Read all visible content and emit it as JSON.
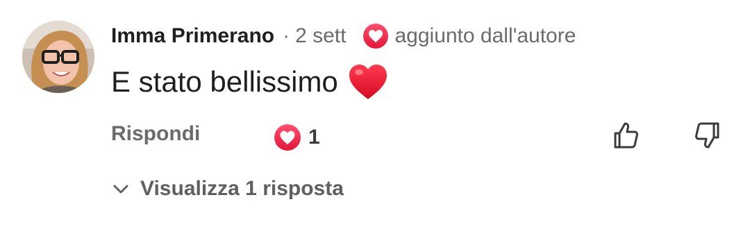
{
  "comment": {
    "author": "Imma Primerano",
    "separator": "·",
    "time": "2 sett",
    "author_badge": "aggiunto dall'autore",
    "text": "E stato bellissimo",
    "emoji_icon": "red-heart-emoji"
  },
  "actions": {
    "reply_label": "Rispondi",
    "reaction_count": "1",
    "like_icon": "thumbs-up-icon",
    "dislike_icon": "thumbs-down-icon"
  },
  "replies": {
    "label": "Visualizza 1 risposta"
  },
  "colors": {
    "heart_gradient_top": "#ff4f6d",
    "heart_gradient_bottom": "#e4163a",
    "emoji_red": "#e8112d",
    "text_primary": "#1f1f1f",
    "text_secondary": "#6b6b6b"
  }
}
